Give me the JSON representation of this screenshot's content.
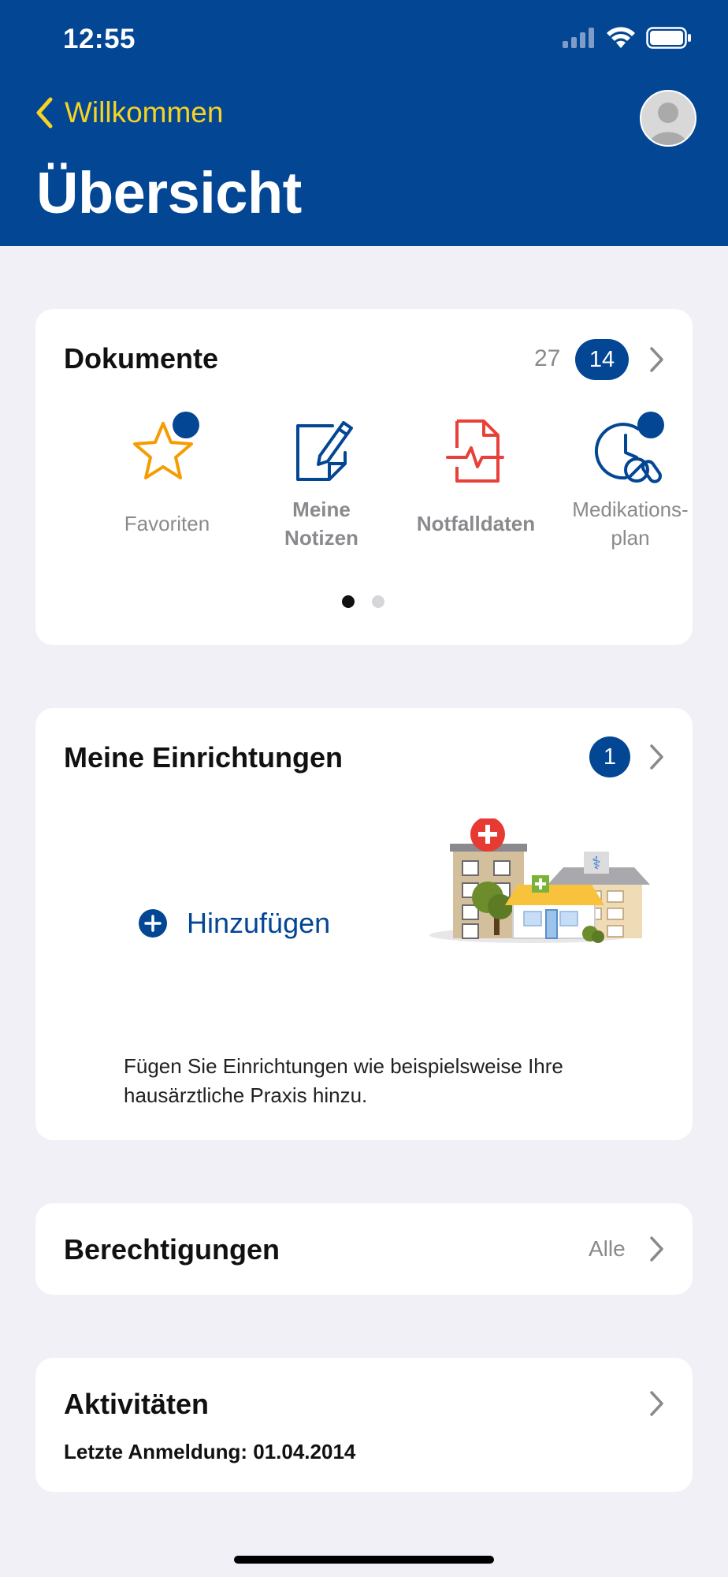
{
  "status_bar": {
    "time": "12:55"
  },
  "nav": {
    "back_label": "Willkommen",
    "title": "Übersicht"
  },
  "documents": {
    "title": "Dokumente",
    "total_count": "27",
    "new_count": "14",
    "items": [
      {
        "label": "Favoriten",
        "icon": "star-icon",
        "badge": true
      },
      {
        "label_line1": "Meine",
        "label_line2": "Notizen",
        "icon": "note-pencil-icon",
        "badge": false
      },
      {
        "label": "Notfalldaten",
        "icon": "emergency-document-icon",
        "badge": false
      },
      {
        "label_line1": "Medikations-",
        "label_line2": "plan",
        "icon": "medication-clock-icon",
        "badge": true
      }
    ],
    "page_indicator": {
      "current": 1,
      "total": 2
    }
  },
  "facilities": {
    "title": "Meine Einrichtungen",
    "count": "1",
    "add_label": "Hinzufügen",
    "description": "Fügen Sie Einrichtungen wie beispielsweise Ihre hausärztliche Praxis hinzu."
  },
  "permissions": {
    "title": "Berechtigungen",
    "value": "Alle"
  },
  "activities": {
    "title": "Aktivitäten",
    "last_login": "Letzte Anmeldung: 01.04.2014"
  },
  "colors": {
    "brand_blue": "#034693",
    "accent_yellow": "#f6d324",
    "background": "#f0f0f6"
  }
}
